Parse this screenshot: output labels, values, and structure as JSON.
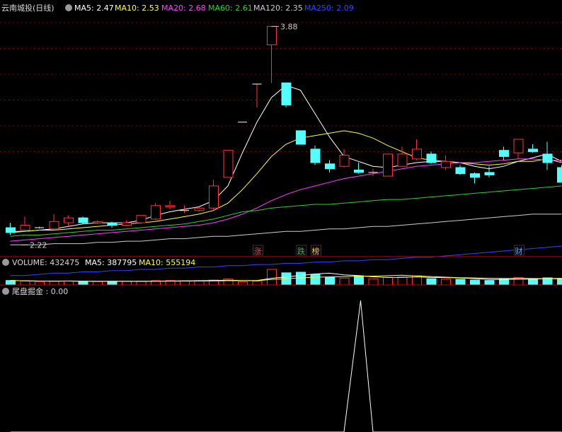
{
  "header": {
    "title": "云南城投(日线)",
    "ma5": "MA5: 2.47",
    "ma10": "MA10: 2.53",
    "ma20": "MA20: 2.68",
    "ma60": "MA60: 2.61",
    "ma120": "MA120: 2.35",
    "ma250": "MA250: 2.09"
  },
  "price_panel": {
    "high_label": "3.88",
    "low_label": "2.22",
    "events": [
      {
        "label": "涨",
        "index": 17,
        "color": "#ff4040"
      },
      {
        "label": "跌",
        "index": 20,
        "color": "#30c030"
      },
      {
        "label": "榜",
        "index": 21,
        "color": "#ffcc33"
      },
      {
        "label": "财",
        "index": 35,
        "color": "#6fa8ff"
      }
    ]
  },
  "volume_panel": {
    "label": "VOLUME: 432475",
    "ma5": "MA5: 387795",
    "ma10": "MA10: 555194"
  },
  "indicator_panel": {
    "label": "尾盘掘金 : 0.00"
  },
  "colors": {
    "up": "#ff3232",
    "down": "#54ffff",
    "ma5": "#ffffff",
    "ma10": "#ffff40",
    "ma20": "#ff40ff",
    "ma60": "#30d030",
    "ma120": "#cccccc",
    "ma250": "#3344ff",
    "grid": "#7a0000"
  },
  "chart_data": [
    {
      "type": "candlestick",
      "title": "云南城投(日线)",
      "ylim": [
        2.05,
        3.98
      ],
      "candles": [
        {
          "o": 2.24,
          "c": 2.2,
          "h": 2.28,
          "l": 2.18
        },
        {
          "o": 2.22,
          "c": 2.26,
          "h": 2.33,
          "l": 2.21
        },
        {
          "o": 2.24,
          "c": 2.24,
          "h": 2.25,
          "l": 2.23
        },
        {
          "o": 2.23,
          "c": 2.29,
          "h": 2.35,
          "l": 2.22
        },
        {
          "o": 2.28,
          "c": 2.32,
          "h": 2.34,
          "l": 2.25
        },
        {
          "o": 2.32,
          "c": 2.28,
          "h": 2.33,
          "l": 2.27
        },
        {
          "o": 2.28,
          "c": 2.29,
          "h": 2.3,
          "l": 2.27
        },
        {
          "o": 2.28,
          "c": 2.26,
          "h": 2.29,
          "l": 2.24
        },
        {
          "o": 2.26,
          "c": 2.28,
          "h": 2.3,
          "l": 2.25
        },
        {
          "o": 2.28,
          "c": 2.34,
          "h": 2.34,
          "l": 2.27
        },
        {
          "o": 2.31,
          "c": 2.42,
          "h": 2.44,
          "l": 2.3
        },
        {
          "o": 2.41,
          "c": 2.42,
          "h": 2.46,
          "l": 2.39
        },
        {
          "o": 2.38,
          "c": 2.38,
          "h": 2.42,
          "l": 2.36
        },
        {
          "o": 2.38,
          "c": 2.4,
          "h": 2.41,
          "l": 2.37
        },
        {
          "o": 2.4,
          "c": 2.58,
          "h": 2.63,
          "l": 2.39
        },
        {
          "o": 2.65,
          "c": 2.87,
          "h": 2.87,
          "l": 2.65
        },
        {
          "o": 3.1,
          "c": 3.1,
          "h": 3.1,
          "l": 3.1
        },
        {
          "o": 3.41,
          "c": 3.41,
          "h": 3.41,
          "l": 3.22
        },
        {
          "o": 3.73,
          "c": 3.88,
          "h": 3.88,
          "l": 3.42
        },
        {
          "o": 3.42,
          "c": 3.24,
          "h": 3.42,
          "l": 3.22
        },
        {
          "o": 3.03,
          "c": 2.92,
          "h": 3.03,
          "l": 2.92
        },
        {
          "o": 2.88,
          "c": 2.77,
          "h": 2.91,
          "l": 2.75
        },
        {
          "o": 2.76,
          "c": 2.72,
          "h": 2.79,
          "l": 2.69
        },
        {
          "o": 2.74,
          "c": 2.83,
          "h": 2.88,
          "l": 2.73
        },
        {
          "o": 2.71,
          "c": 2.69,
          "h": 2.77,
          "l": 2.68
        },
        {
          "o": 2.69,
          "c": 2.69,
          "h": 2.72,
          "l": 2.66
        },
        {
          "o": 2.66,
          "c": 2.84,
          "h": 2.84,
          "l": 2.66
        },
        {
          "o": 2.74,
          "c": 2.84,
          "h": 2.9,
          "l": 2.74
        },
        {
          "o": 2.8,
          "c": 2.88,
          "h": 2.96,
          "l": 2.79
        },
        {
          "o": 2.84,
          "c": 2.77,
          "h": 2.86,
          "l": 2.76
        },
        {
          "o": 2.73,
          "c": 2.78,
          "h": 2.83,
          "l": 2.71
        },
        {
          "o": 2.73,
          "c": 2.68,
          "h": 2.75,
          "l": 2.67
        },
        {
          "o": 2.68,
          "c": 2.65,
          "h": 2.69,
          "l": 2.6
        },
        {
          "o": 2.69,
          "c": 2.67,
          "h": 2.74,
          "l": 2.65
        },
        {
          "o": 2.87,
          "c": 2.82,
          "h": 2.9,
          "l": 2.79
        },
        {
          "o": 2.85,
          "c": 2.96,
          "h": 2.96,
          "l": 2.8
        },
        {
          "o": 2.88,
          "c": 2.86,
          "h": 2.92,
          "l": 2.85
        },
        {
          "o": 2.84,
          "c": 2.77,
          "h": 2.94,
          "l": 2.71
        },
        {
          "o": 2.73,
          "c": 2.61,
          "h": 2.75,
          "l": 2.61
        }
      ],
      "ma": [
        {
          "name": "MA5",
          "values": [
            2.2,
            2.21,
            2.22,
            2.23,
            2.25,
            2.27,
            2.28,
            2.28,
            2.28,
            2.3,
            2.34,
            2.37,
            2.39,
            2.41,
            2.46,
            2.58,
            2.85,
            3.1,
            3.3,
            3.4,
            3.36,
            3.17,
            2.98,
            2.82,
            2.78,
            2.74,
            2.73,
            2.75,
            2.77,
            2.78,
            2.78,
            2.77,
            2.74,
            2.72,
            2.74,
            2.78,
            2.81,
            2.84,
            2.78
          ]
        },
        {
          "name": "MA10",
          "values": [
            2.21,
            2.21,
            2.22,
            2.22,
            2.23,
            2.24,
            2.25,
            2.26,
            2.27,
            2.28,
            2.29,
            2.31,
            2.33,
            2.35,
            2.38,
            2.44,
            2.55,
            2.68,
            2.82,
            2.92,
            2.97,
            2.99,
            3.01,
            3.03,
            3.01,
            2.97,
            2.91,
            2.86,
            2.81,
            2.79,
            2.78,
            2.77,
            2.76,
            2.75,
            2.76,
            2.78,
            2.78,
            2.8,
            2.77
          ]
        },
        {
          "name": "MA20",
          "values": [
            2.13,
            2.14,
            2.15,
            2.16,
            2.17,
            2.18,
            2.19,
            2.2,
            2.21,
            2.22,
            2.23,
            2.24,
            2.25,
            2.26,
            2.28,
            2.31,
            2.35,
            2.4,
            2.46,
            2.51,
            2.55,
            2.58,
            2.61,
            2.64,
            2.66,
            2.68,
            2.7,
            2.72,
            2.74,
            2.75,
            2.76,
            2.77,
            2.77,
            2.78,
            2.79,
            2.8,
            2.8,
            2.79,
            2.79
          ]
        },
        {
          "name": "MA60",
          "values": [
            2.17,
            2.18,
            2.18,
            2.19,
            2.2,
            2.21,
            2.22,
            2.22,
            2.23,
            2.24,
            2.25,
            2.26,
            2.27,
            2.29,
            2.31,
            2.34,
            2.37,
            2.38,
            2.4,
            2.41,
            2.42,
            2.43,
            2.43,
            2.44,
            2.45,
            2.46,
            2.47,
            2.47,
            2.48,
            2.49,
            2.5,
            2.51,
            2.52,
            2.53,
            2.54,
            2.55,
            2.56,
            2.57,
            2.58
          ]
        },
        {
          "name": "MA120",
          "values": [
            2.1,
            2.1,
            2.1,
            2.11,
            2.11,
            2.11,
            2.12,
            2.12,
            2.13,
            2.13,
            2.14,
            2.15,
            2.15,
            2.16,
            2.17,
            2.17,
            2.18,
            2.19,
            2.2,
            2.21,
            2.21,
            2.22,
            2.23,
            2.23,
            2.24,
            2.25,
            2.25,
            2.26,
            2.27,
            2.28,
            2.29,
            2.3,
            2.31,
            2.32,
            2.33,
            2.34,
            2.35,
            2.35,
            2.35
          ]
        },
        {
          "name": "MA250",
          "values": [
            1.85,
            1.85,
            1.86,
            1.87,
            1.87,
            1.88,
            1.88,
            1.89,
            1.89,
            1.9,
            1.9,
            1.91,
            1.91,
            1.92,
            1.92,
            1.93,
            1.93,
            1.94,
            1.94,
            1.95,
            1.95,
            1.96,
            1.96,
            1.97,
            1.97,
            1.98,
            1.98,
            1.99,
            2.0,
            2.0,
            2.01,
            2.02,
            2.03,
            2.04,
            2.05,
            2.06,
            2.07,
            2.08,
            2.09
          ]
        }
      ]
    },
    {
      "type": "bar",
      "title": "VOLUME",
      "values": [
        300000,
        260000,
        230000,
        250000,
        270000,
        220000,
        230000,
        240000,
        250000,
        260000,
        290000,
        300000,
        280000,
        290000,
        330000,
        400000,
        210000,
        250000,
        1050000,
        820000,
        860000,
        720000,
        520000,
        460000,
        620000,
        420000,
        520000,
        540000,
        620000,
        420000,
        400000,
        380000,
        330000,
        300000,
        420000,
        500000,
        420000,
        480000,
        432475
      ]
    },
    {
      "type": "line",
      "title": "尾盘掘金",
      "ylim": [
        0,
        1
      ],
      "values": [
        0,
        0,
        0,
        0,
        0,
        0,
        0,
        0,
        0,
        0,
        0,
        0,
        0,
        0,
        0,
        0,
        0,
        0,
        0,
        0,
        0,
        0,
        0,
        0,
        1,
        0,
        0,
        0,
        0,
        0,
        0,
        0,
        0,
        0,
        0,
        0,
        0,
        0,
        0
      ]
    }
  ]
}
